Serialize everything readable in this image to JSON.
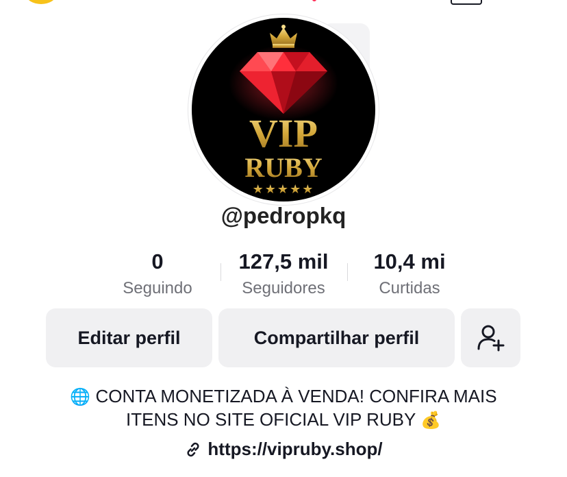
{
  "profile": {
    "username": "@pedropkq",
    "avatar_logo_line1": "VIP",
    "avatar_logo_line2": "RUBY",
    "avatar_stars": "★★★★★"
  },
  "stats": [
    {
      "value": "0",
      "label": "Seguindo"
    },
    {
      "value": "127,5 mil",
      "label": "Seguidores"
    },
    {
      "value": "10,4 mi",
      "label": "Curtidas"
    }
  ],
  "buttons": {
    "edit": "Editar perfil",
    "share": "Compartilhar perfil"
  },
  "bio": {
    "globe": "🌐",
    "line1": "CONTA MONETIZADA À VENDA! CONFIRA MAIS",
    "line2": "ITENS NO SITE OFICIAL VIP RUBY",
    "money": "💰"
  },
  "link": {
    "url": "https://vipruby.shop/"
  },
  "colors": {
    "accent_gold": "#d4a83a",
    "ruby": "#e0162b",
    "button_bg": "#f0f0f2"
  },
  "icons": [
    "link-icon",
    "add-friend-icon",
    "crown-icon",
    "ruby-gem-icon"
  ]
}
